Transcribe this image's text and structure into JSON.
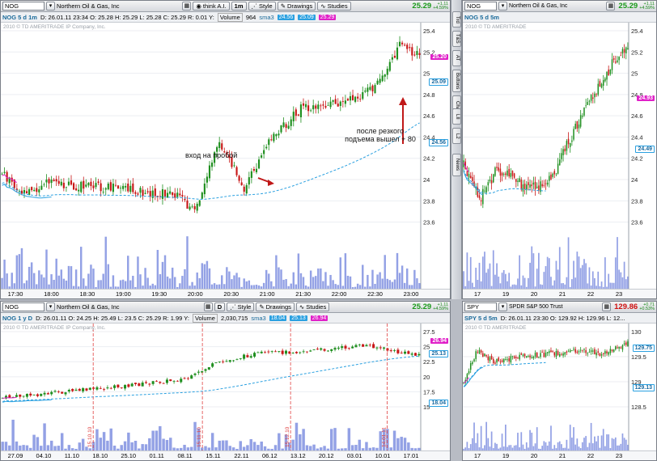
{
  "panes": {
    "main": {
      "symbol": "NOG",
      "company": "Northern Oil & Gas, Inc",
      "ai_button": "think A.I.",
      "aggregation": "1m",
      "style_label": "Style",
      "drawings_label": "Drawings",
      "studies_label": "Studies",
      "last_price": "25.29",
      "change": "+1.11",
      "change_pct": "+4.59%",
      "title": "NOG 5 d 1m",
      "info": "D: 26.01.11 23:34  O: 25.28  H: 25.29  L: 25.28  C: 25.29  R: 0.01  Y:",
      "volume_label": "Volume",
      "volume_value": "964",
      "sma_label": "sma3",
      "sma_values": [
        "24.56",
        "25.09",
        "25.29"
      ],
      "copyright": "2010 © TD AMERITRADE IP Company, Inc.",
      "y_ticks": [
        "25.4",
        "25.2",
        "25",
        "24.8",
        "24.6",
        "24.4",
        "24.2",
        "24",
        "23.8",
        "23.6"
      ],
      "badges": [
        "25.20",
        "25.09",
        "24.56"
      ],
      "x_ticks": [
        "17:30",
        "18:00",
        "18:30",
        "19:00",
        "19:30",
        "20:00",
        "20:30",
        "21:00",
        "21:30",
        "22:00",
        "22:30",
        "23:00"
      ],
      "annotation_entry": "вход на пробой",
      "annotation_exit": "после резкого подъема вышел + 80"
    },
    "topright": {
      "symbol": "NOG",
      "company": "Northern Oil & Gas, Inc",
      "last_price": "25.29",
      "change": "+1.11",
      "change_pct": "+4.59%",
      "title": "NOG 5 d 5m",
      "copyright": "2010 © TD AMERITRADE",
      "y_ticks": [
        "25.4",
        "25.2",
        "25",
        "24.8",
        "24.6",
        "24.4",
        "24.2",
        "24",
        "23.8",
        "23.6"
      ],
      "badges": [
        "24.93",
        "24.49"
      ],
      "x_ticks": [
        "17",
        "19",
        "20",
        "21",
        "22",
        "23"
      ]
    },
    "bottomleft": {
      "symbol": "NOG",
      "company": "Northern Oil & Gas, Inc",
      "aggregation": "D",
      "style_label": "Style",
      "drawings_label": "Drawings",
      "studies_label": "Studies",
      "last_price": "25.29",
      "change": "+1.11",
      "change_pct": "+4.59%",
      "title": "NOG 1 y D",
      "info": "D: 26.01.11  O: 24.25  H: 25.49  L: 23.5  C: 25.29  R: 1.99  Y:",
      "volume_label": "Volume",
      "volume_value": "2,030,715",
      "sma_label": "sma3",
      "sma_values": [
        "18.04",
        "25.13",
        "26.94"
      ],
      "copyright": "2010 © TD AMERITRADE IP Company, Inc.",
      "y_ticks": [
        "27.5",
        "25",
        "22.5",
        "20",
        "17.5",
        "15"
      ],
      "badges": [
        "26.94",
        "25.13",
        "18.04"
      ],
      "x_ticks": [
        "27.09",
        "04.10",
        "11.10",
        "18.10",
        "25.10",
        "01.11",
        "08.11",
        "15.11",
        "22.11",
        "06.12",
        "13.12",
        "20.12",
        "03.01",
        "10.01",
        "17.01"
      ],
      "vlines": [
        "15.10.10",
        "15.11.10",
        "15.12.10",
        "14.01.11"
      ]
    },
    "bottomright": {
      "symbol": "SPY",
      "company": "SPDR S&P 500 Trust",
      "last_price": "129.86",
      "change": "+0.71",
      "change_pct": "+0.53%",
      "title": "SPY 5 d 5m",
      "info": "D: 26.01.11 23:30  O: 129.92  H: 129.96  L: 12...",
      "copyright": "2010 © TD AMERITRADE",
      "y_ticks": [
        "130",
        "129.5",
        "129",
        "128.5"
      ],
      "badges": [
        "129.75",
        "129.13"
      ],
      "x_ticks": [
        "17",
        "19",
        "20",
        "21",
        "22",
        "23"
      ]
    }
  },
  "sidebar_tabs": [
    "Trd",
    "T&S",
    "AT",
    "Buttons",
    "Chart",
    "LII",
    "L2",
    "News"
  ],
  "colors": {
    "up": "#1f8f1f",
    "down": "#c81818",
    "sma_fast": "#e020c8",
    "sma_slow": "#2aa0e0",
    "volume": "#8090e0",
    "vline": "#e04040"
  }
}
